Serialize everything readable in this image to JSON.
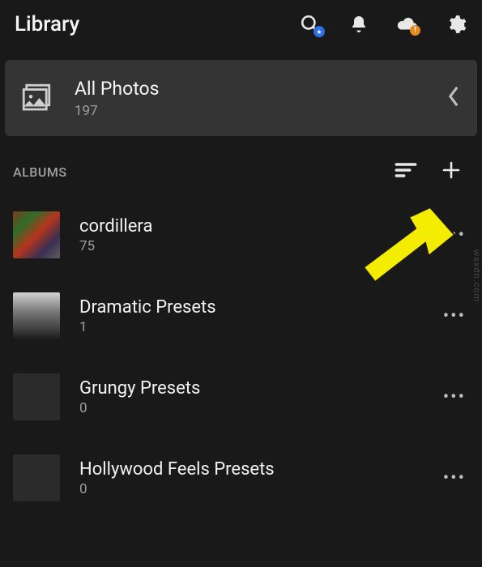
{
  "header": {
    "title": "Library"
  },
  "all_photos": {
    "title": "All Photos",
    "count": "197"
  },
  "section": {
    "label": "ALBUMS"
  },
  "albums": [
    {
      "name": "cordillera",
      "count": "75",
      "thumb": "thumb-cordillera"
    },
    {
      "name": "Dramatic Presets",
      "count": "1",
      "thumb": "thumb-dramatic"
    },
    {
      "name": "Grungy Presets",
      "count": "0",
      "thumb": "thumb-empty"
    },
    {
      "name": "Hollywood Feels Presets",
      "count": "0",
      "thumb": "thumb-empty"
    }
  ],
  "watermark": "wsxdn.com",
  "colors": {
    "bg": "#191919",
    "card": "#343434",
    "accentBlue": "#2d6fe0",
    "warnOrange": "#e48a1e",
    "arrow": "#f4ed00"
  }
}
